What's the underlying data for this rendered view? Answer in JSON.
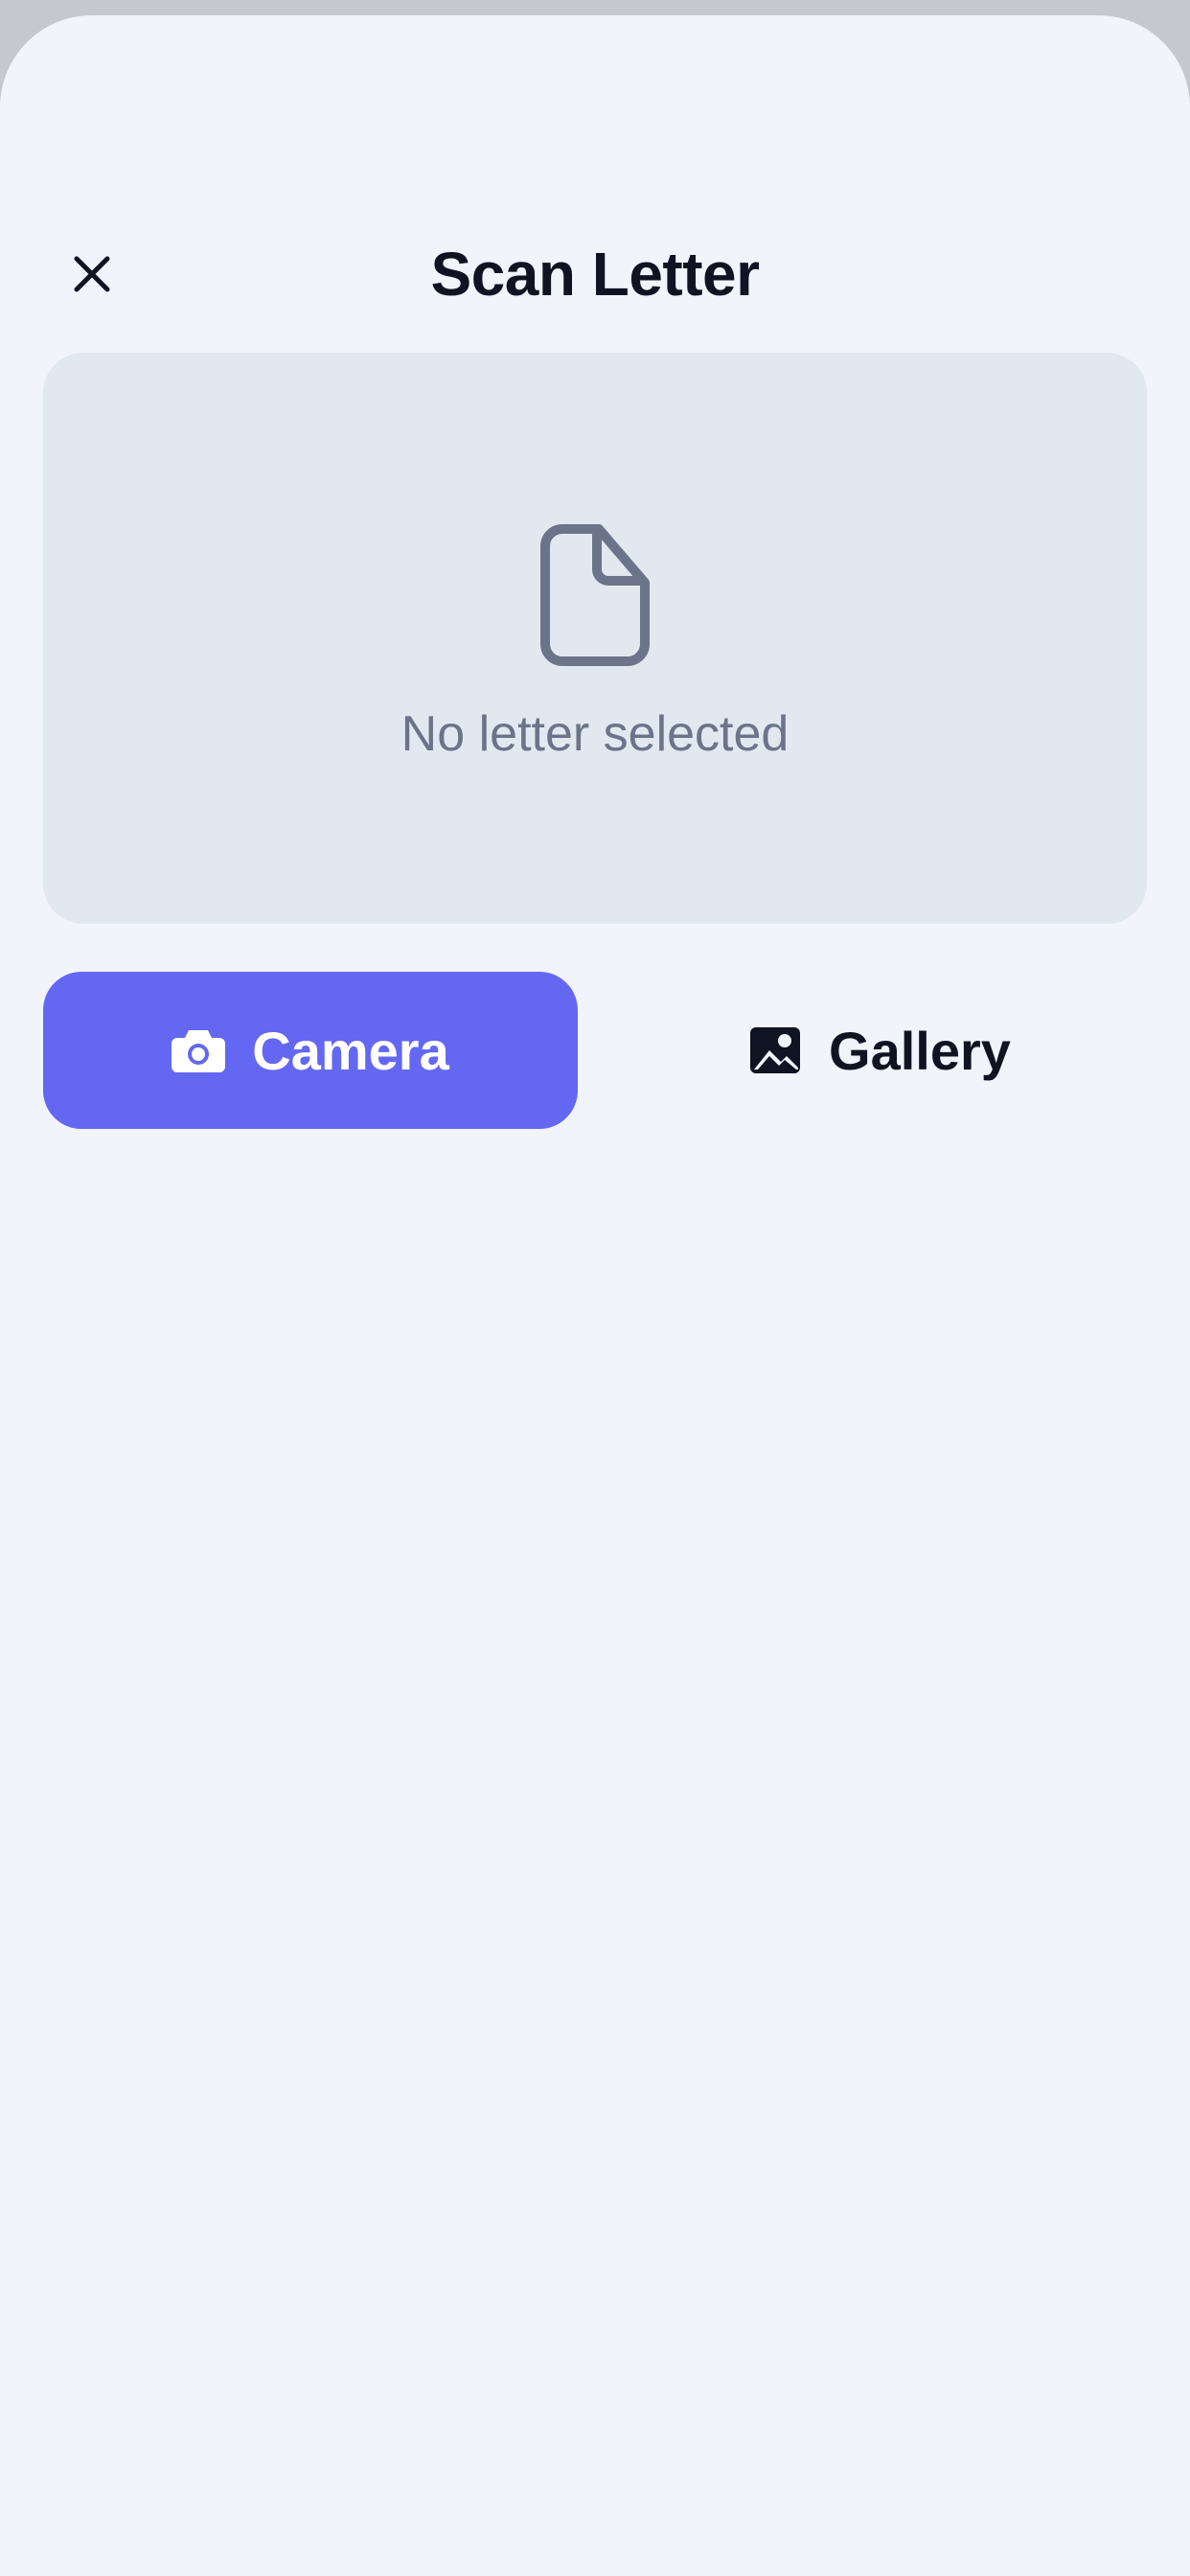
{
  "header": {
    "title": "Scan Letter",
    "close_icon": "close-icon"
  },
  "preview": {
    "icon": "document-icon",
    "empty_text": "No letter selected"
  },
  "actions": {
    "camera": {
      "label": "Camera",
      "icon": "camera-icon"
    },
    "gallery": {
      "label": "Gallery",
      "icon": "image-icon"
    }
  },
  "colors": {
    "background": "#f1f4fb",
    "primary": "#6467f2",
    "preview_bg": "#e2e8f0",
    "muted_text": "#6b7488",
    "title_text": "#0f1322"
  }
}
